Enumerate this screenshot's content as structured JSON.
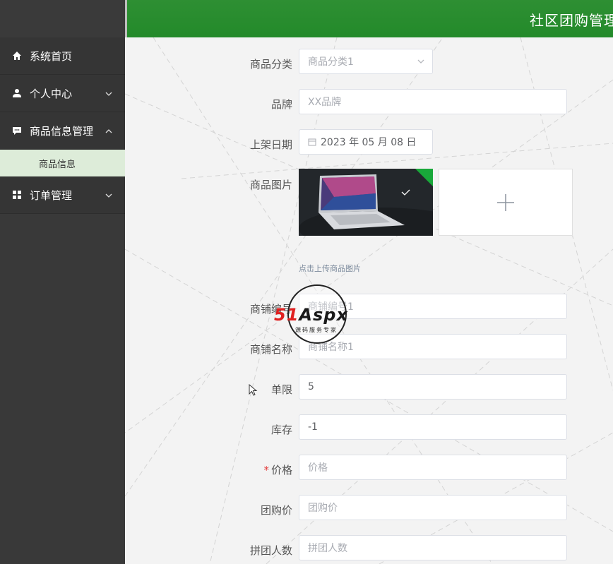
{
  "header": {
    "title": "社区团购管理"
  },
  "sidebar": {
    "items": [
      {
        "label": "系统首页",
        "icon": "home-icon"
      },
      {
        "label": "个人中心",
        "icon": "user-icon"
      },
      {
        "label": "商品信息管理",
        "icon": "chat-icon"
      },
      {
        "label": "订单管理",
        "icon": "grid-icon"
      }
    ],
    "sub_items": [
      {
        "label": "商品信息"
      }
    ]
  },
  "form": {
    "category": {
      "label": "商品分类",
      "value": "商品分类1"
    },
    "brand": {
      "label": "品牌",
      "value": "XX品牌"
    },
    "date": {
      "label": "上架日期",
      "value": "2023 年 05 月 08 日"
    },
    "image": {
      "label": "商品图片",
      "hint": "点击上传商品图片"
    },
    "shop_no": {
      "label": "商铺编号",
      "value": "商铺编号1"
    },
    "shop_name": {
      "label": "商铺名称",
      "value": "商铺名称1"
    },
    "limit": {
      "label": "单限",
      "value": "5"
    },
    "stock": {
      "label": "库存",
      "value": "-1"
    },
    "price": {
      "label": "价格",
      "placeholder": "价格",
      "required_mark": "*"
    },
    "group_price": {
      "label": "团购价",
      "placeholder": "团购价"
    },
    "group_people": {
      "label": "拼团人数",
      "placeholder": "拼团人数"
    }
  },
  "watermark": {
    "brand": "51Aspx",
    "brand_left": "51",
    "brand_right": "Aspx",
    "tagline": "源码服务专家"
  },
  "colors": {
    "accent": "#2e8f33",
    "sidebar": "#393939",
    "submenu": "#ddecd9",
    "required": "#e23a3a"
  }
}
